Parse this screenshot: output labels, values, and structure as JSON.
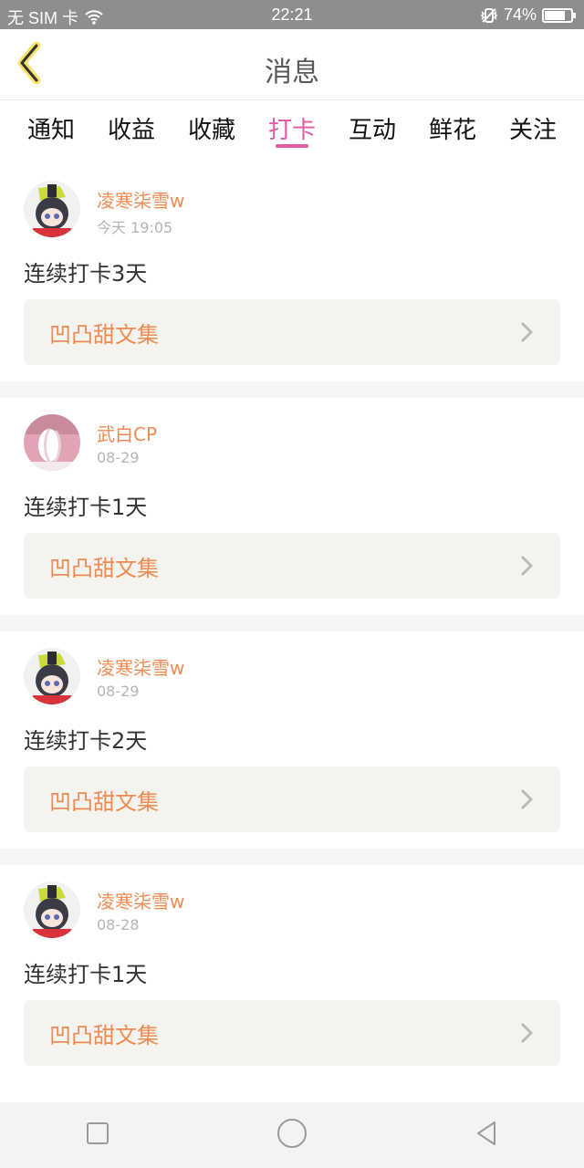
{
  "status_bar": {
    "sim_text": "无 SIM 卡",
    "time": "22:21",
    "battery": "74%"
  },
  "header": {
    "title": "消息"
  },
  "tabs": [
    {
      "label": "通知",
      "active": false
    },
    {
      "label": "收益",
      "active": false
    },
    {
      "label": "收藏",
      "active": false
    },
    {
      "label": "打卡",
      "active": true
    },
    {
      "label": "互动",
      "active": false
    },
    {
      "label": "鲜花",
      "active": false
    },
    {
      "label": "关注",
      "active": false
    }
  ],
  "feed": [
    {
      "user": "凌寒柒雪w",
      "time": "今天 19:05",
      "content": "连续打卡3天",
      "collection": "凹凸甜文集",
      "avatar": "anime-avatar"
    },
    {
      "user": "武白CP",
      "time": "08-29",
      "content": "连续打卡1天",
      "collection": "凹凸甜文集",
      "avatar": "pink-avatar"
    },
    {
      "user": "凌寒柒雪w",
      "time": "08-29",
      "content": "连续打卡2天",
      "collection": "凹凸甜文集",
      "avatar": "anime-avatar"
    },
    {
      "user": "凌寒柒雪w",
      "time": "08-28",
      "content": "连续打卡1天",
      "collection": "凹凸甜文集",
      "avatar": "anime-avatar"
    }
  ],
  "colors": {
    "accent": "#e05aa4",
    "orange": "#f08a53",
    "status_bg": "#8e8e8e",
    "card_link_bg": "#f4f3ee"
  },
  "icons": {
    "back": "chevron-left-icon",
    "wifi": "wifi-icon",
    "vibrate": "vibrate-icon",
    "battery": "battery-icon",
    "nav_square": "square-icon",
    "nav_circle": "circle-icon",
    "nav_triangle": "back-triangle-icon",
    "link_chevron": "chevron-right-icon"
  }
}
